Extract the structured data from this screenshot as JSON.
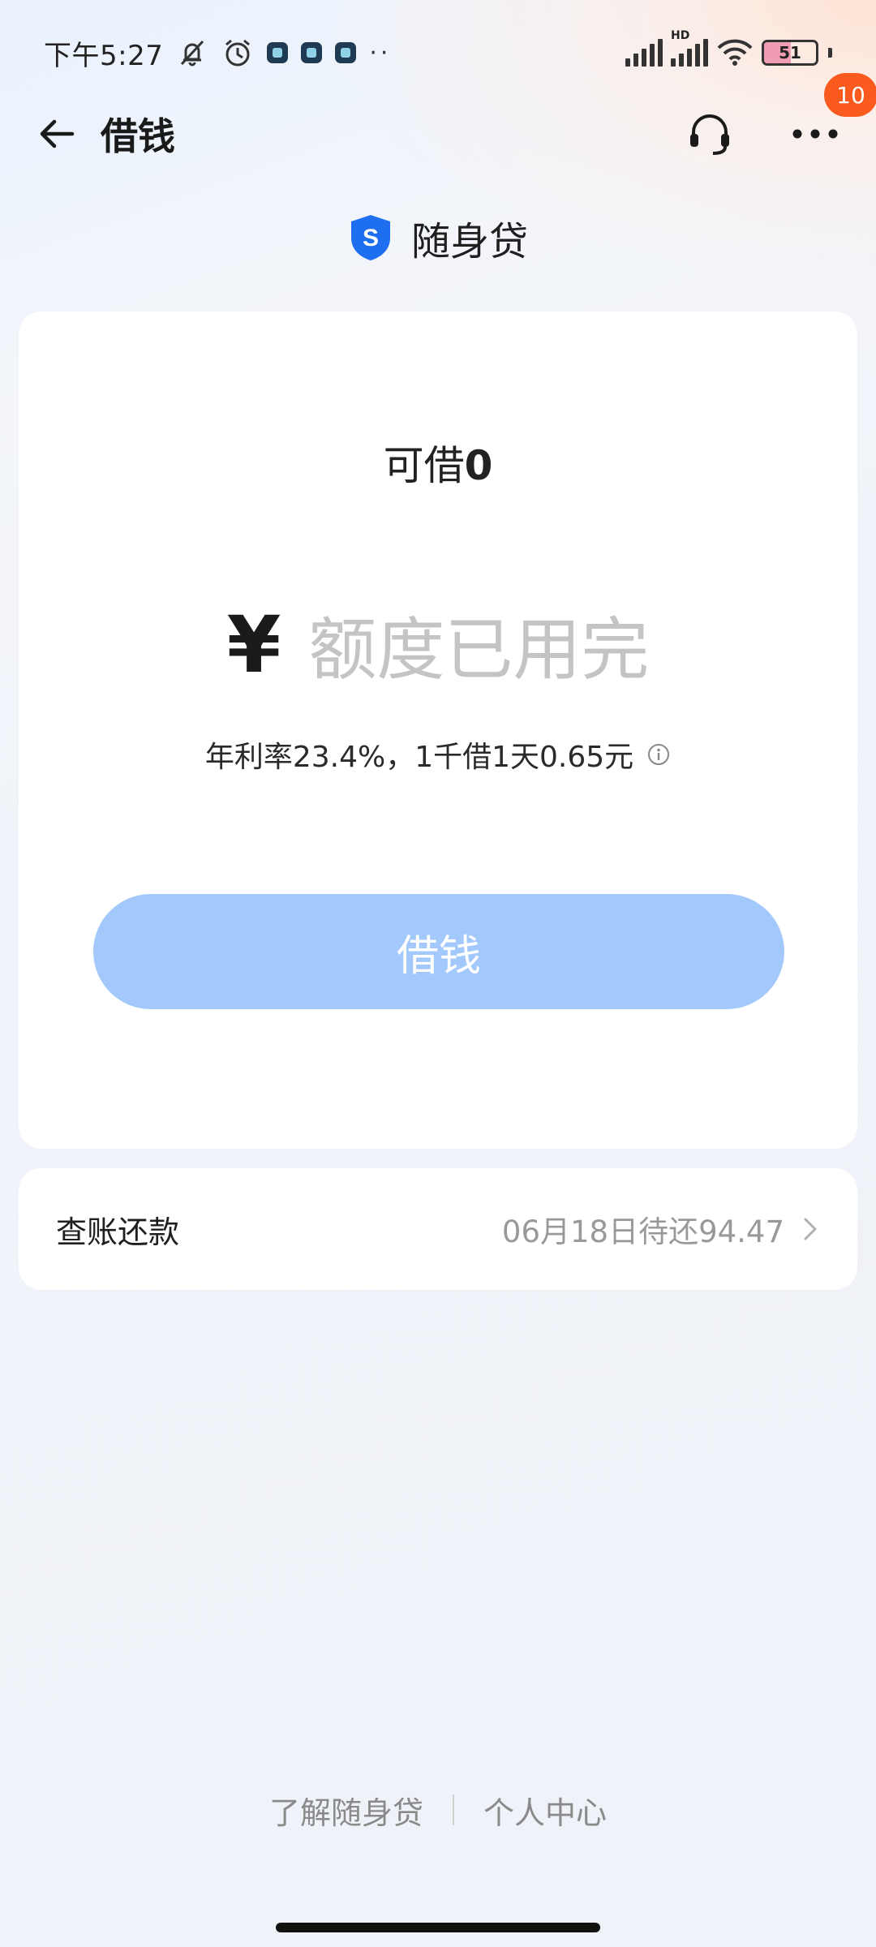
{
  "status_bar": {
    "time": "下午5:27",
    "battery_level": "51",
    "hd_label": "HD"
  },
  "nav": {
    "title": "借钱",
    "notification_count": "10"
  },
  "product": {
    "name": "随身贷",
    "logo_letter": "S"
  },
  "loan": {
    "available_label": "可借",
    "available_amount": "0",
    "currency_symbol": "¥",
    "amount_status": "额度已用完",
    "rate_text": "年利率23.4%，1千借1天0.65元",
    "borrow_button_label": "借钱"
  },
  "bill": {
    "label": "查账还款",
    "status": "06月18日待还94.47"
  },
  "footer": {
    "link_about": "了解随身贷",
    "link_personal": "个人中心"
  },
  "colors": {
    "accent": "#1e6ff0",
    "button_disabled": "#a3c8fb",
    "badge": "#fb5a1e"
  },
  "icons": {
    "back": "back-arrow-icon",
    "support": "headset-icon",
    "more": "more-dots-icon",
    "info": "info-icon",
    "chevron": "chevron-right-icon",
    "logo": "shield-logo-icon"
  }
}
